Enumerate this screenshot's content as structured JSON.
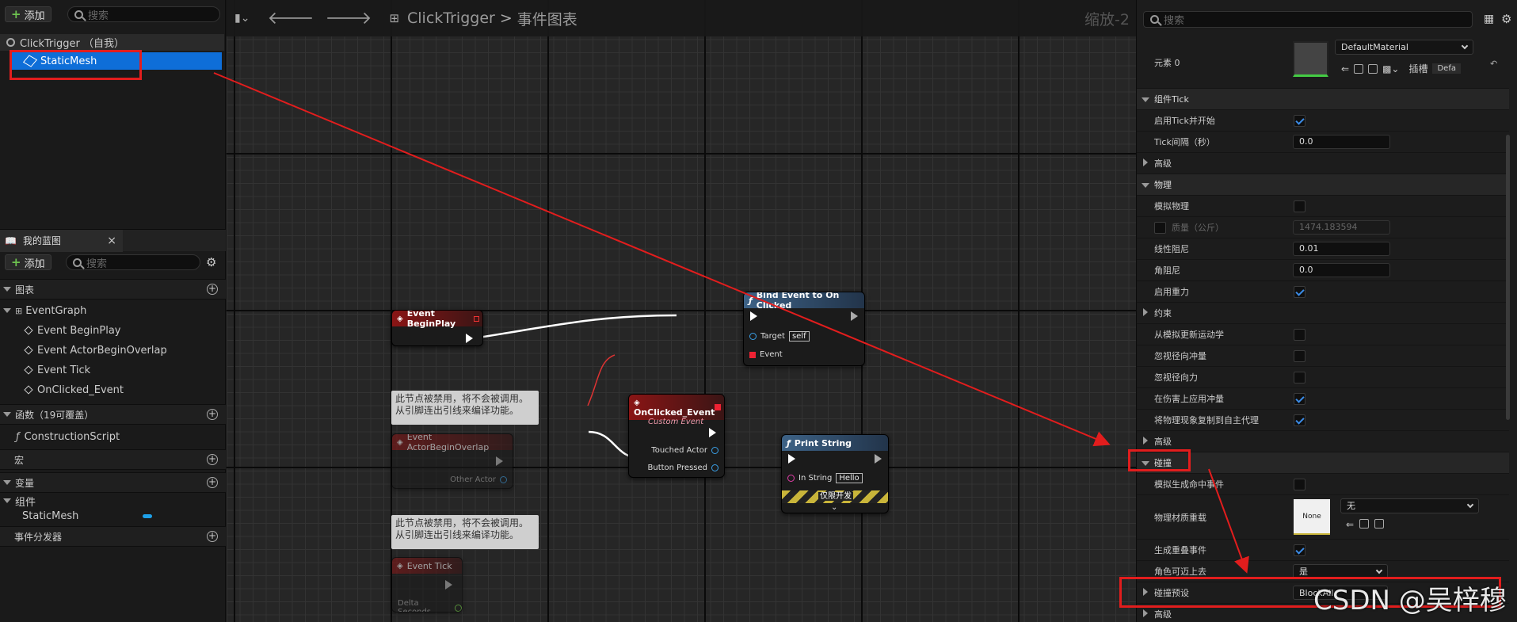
{
  "left": {
    "add_label": "添加",
    "search_placeholder": "搜索",
    "components": {
      "root": "ClickTrigger （自我）",
      "child": "StaticMesh"
    },
    "my_blueprint": {
      "tab": "我的蓝图",
      "add_label": "添加",
      "search_placeholder": "搜索"
    },
    "sections": {
      "graphs": "图表",
      "functions": "函数（19可覆盖）",
      "macros": "宏",
      "variables": "变量",
      "components_cat": "组件",
      "dispatchers": "事件分发器"
    },
    "event_graph": "EventGraph",
    "events": [
      "Event BeginPlay",
      "Event ActorBeginOverlap",
      "Event Tick",
      "OnClicked_Event"
    ],
    "construction": "ConstructionScript",
    "component_var": "StaticMesh"
  },
  "graph": {
    "title": "ClickTrigger",
    "sep": ">",
    "subtitle": "事件图表",
    "zoom": "缩放-2",
    "nodes": {
      "begin_play": "Event BeginPlay",
      "bind": {
        "title": "Bind Event to On Clicked",
        "target": "Target",
        "target_val": "self",
        "event": "Event"
      },
      "onclicked": {
        "title": "OnClicked_Event",
        "sub": "Custom Event",
        "touched": "Touched Actor",
        "button": "Button Pressed"
      },
      "print": {
        "title": "Print String",
        "in": "In String",
        "in_val": "Hello",
        "dev": "仅限开发"
      },
      "overlap": {
        "title": "Event ActorBeginOverlap",
        "other": "Other Actor"
      },
      "tick": {
        "title": "Event Tick",
        "delta": "Delta Seconds"
      },
      "disabled_comment": "此节点被禁用，将不会被调用。\n从引脚连出引线来编译功能。"
    }
  },
  "details": {
    "search_placeholder": "搜索",
    "element0": "元素 0",
    "material": "DefaultMaterial",
    "slot": "插槽",
    "slot_val": "Defa",
    "rows": {
      "tick_cat": "组件Tick",
      "tick_enable": "启用Tick并开始",
      "tick_interval": "Tick间隔（秒）",
      "tick_interval_val": "0.0",
      "adv1": "高级",
      "physics_cat": "物理",
      "sim_physics": "模拟物理",
      "mass": "质量（公斤）",
      "mass_val": "1474.183594",
      "linear_damp": "线性阻尼",
      "linear_damp_val": "0.01",
      "angular_damp": "角阻尼",
      "angular_damp_val": "0.0",
      "gravity": "启用重力",
      "constraints": "约束",
      "update_kin": "从模拟更新运动学",
      "ignore_radial_impulse": "忽视径向冲量",
      "ignore_radial_force": "忽视径向力",
      "apply_impulse": "在伤害上应用冲量",
      "replicate_physics": "将物理现象复制到自主代理",
      "adv2": "高级",
      "collision_cat": "碰撞",
      "sim_hit": "模拟生成命中事件",
      "phys_material": "物理材质重载",
      "phys_material_thumb": "None",
      "phys_material_val": "无",
      "gen_overlap": "生成重叠事件",
      "can_step": "角色可迈上去",
      "can_step_val": "是",
      "collision_preset": "碰撞预设",
      "collision_preset_val": "BlockAll",
      "adv3": "高级"
    }
  },
  "watermark": "CSDN @吴梓穆",
  "colors": {
    "highlight": "#e21d1d",
    "selection": "#0e6ed8",
    "exec": "#ffffff"
  }
}
